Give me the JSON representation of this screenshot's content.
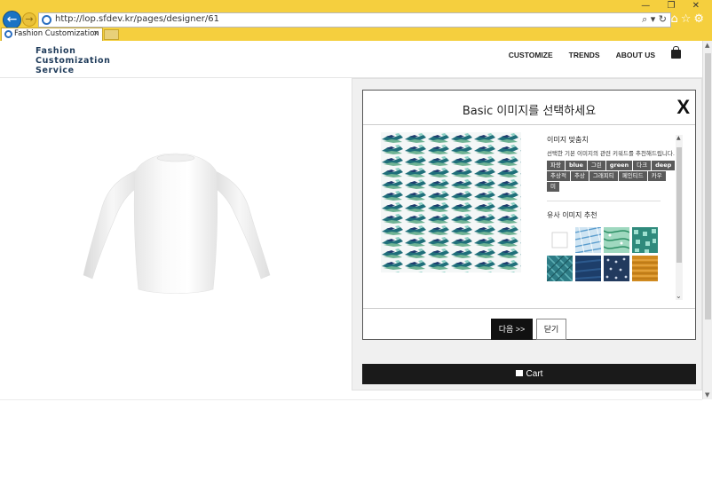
{
  "browser": {
    "url": "http://lop.sfdev.kr/pages/designer/61",
    "tab_title": "Fashion Customization Ser...",
    "tab_close": "×",
    "window_controls": "— ❐ ✕",
    "address_tools": "⌕ ▾ ↻",
    "toolbar_icons": "⌂☆⚙"
  },
  "header": {
    "logo": [
      "Fashion",
      "Customization",
      "Service"
    ],
    "nav": [
      "CUSTOMIZE",
      "TRENDS",
      "ABOUT US"
    ]
  },
  "modal": {
    "title": "Basic 이미지를 선택하세요",
    "close_label": "X",
    "keyword_heading": "이미지 맞춤치",
    "keyword_desc": "선택한 기본 이미지의 관련 키워드를 추천해드립니다.",
    "tags": [
      {
        "label": "파랑",
        "bold": false
      },
      {
        "label": "blue",
        "bold": true
      },
      {
        "label": "그린",
        "bold": false
      },
      {
        "label": "green",
        "bold": true
      },
      {
        "label": "다크",
        "bold": false
      },
      {
        "label": "deep",
        "bold": true
      },
      {
        "label": "추상적",
        "bold": false
      },
      {
        "label": "추상",
        "bold": false
      },
      {
        "label": "그래피티",
        "bold": false
      },
      {
        "label": "페인티드",
        "bold": false
      },
      {
        "label": "카우",
        "bold": false
      },
      {
        "label": "미",
        "bold": false
      }
    ],
    "similar_heading": "유사 이미지 추천",
    "thumbs": [
      {
        "color": "#ffffff",
        "pattern": "blank"
      },
      {
        "color": "#7fb6d8",
        "pattern": "light-blue"
      },
      {
        "color": "#7cc9a4",
        "pattern": "mint"
      },
      {
        "color": "#2f8a7c",
        "pattern": "teal"
      },
      {
        "color": "#2e7c86",
        "pattern": "teal-dark"
      },
      {
        "color": "#1d3e6a",
        "pattern": "navy"
      },
      {
        "color": "#223a5e",
        "pattern": "navy-dots"
      },
      {
        "color": "#d08a1f",
        "pattern": "orange"
      }
    ],
    "next_label": "다음 >>",
    "close_button_label": "닫기"
  },
  "cart_label": "Cart",
  "colors": {
    "browser_bar": "#f5cf3e",
    "dark_button": "#111111",
    "pattern_teal": "#1f6f7a",
    "pattern_green": "#6fb394",
    "pattern_navy": "#1e3a6e"
  }
}
